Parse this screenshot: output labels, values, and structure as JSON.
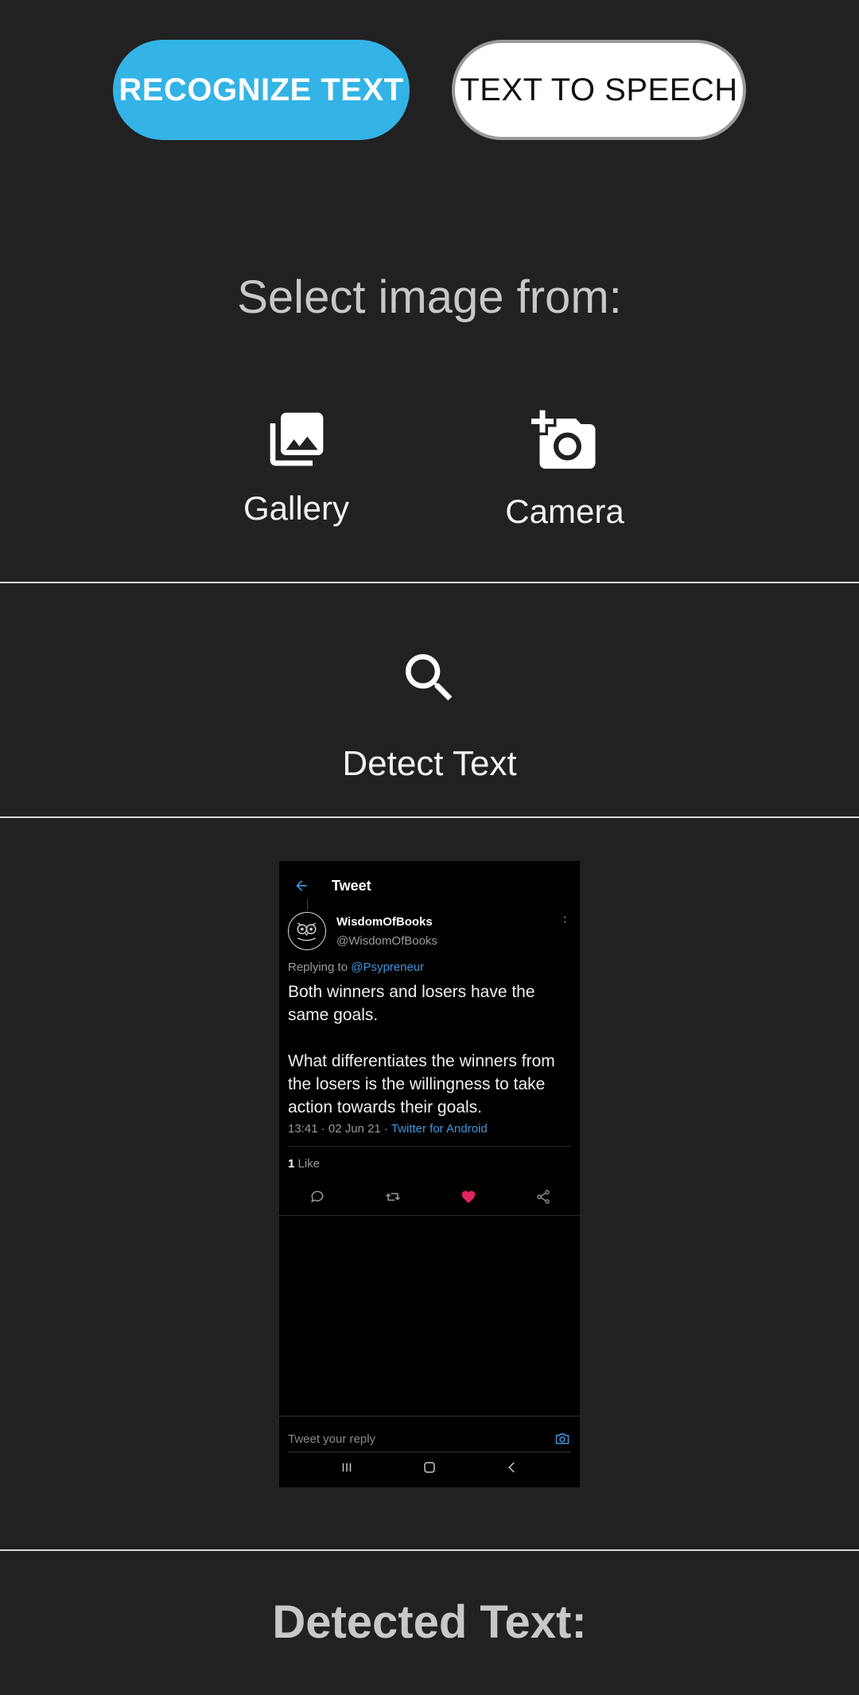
{
  "top_buttons": {
    "recognize": "RECOGNIZE TEXT",
    "tts": "TEXT TO SPEECH"
  },
  "select_title": "Select image from:",
  "options": {
    "gallery": "Gallery",
    "camera": "Camera"
  },
  "detect": {
    "label": "Detect Text"
  },
  "preview": {
    "header_title": "Tweet",
    "name": "WisdomOfBooks",
    "handle": "@WisdomOfBooks",
    "replying_prefix": "Replying to",
    "replying_to": "@Psypreneur",
    "body_line1": "Both winners and losers have the same goals.",
    "body_line2": "What differentiates the winners from the losers is the willingness to take action towards their goals.",
    "meta": "13:41 · 02 Jun 21 ·",
    "source": "Twitter for Android",
    "likes_count": "1",
    "likes_label": "Like",
    "reply_placeholder": "Tweet your reply"
  },
  "detected_title": "Detected Text:",
  "colors": {
    "accent": "#33b3e6",
    "background": "#212121",
    "like": "#e0245e",
    "link": "#3f95e0"
  }
}
